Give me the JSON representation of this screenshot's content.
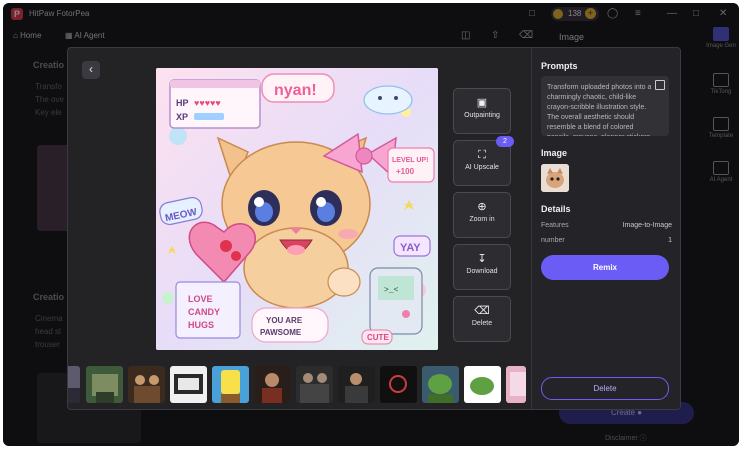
{
  "app": {
    "title": "HitPaw FotorPea",
    "coins": "138",
    "coin_plus": "+"
  },
  "nav": {
    "home": "Home",
    "ai_agent": "AI Agent"
  },
  "right_panel": {
    "title": "Image",
    "rail": [
      "Image Gen",
      "TikTong",
      "Template",
      "AI Agent"
    ],
    "create_label": "Create",
    "disclaimer": "Disclaimer"
  },
  "background": {
    "section1_title": "Creatio",
    "section1_lines": [
      "Transfo",
      "The ove",
      "Key ele"
    ],
    "section2_title": "Creatio",
    "section2_lines": [
      "Cinema",
      "head sl",
      "trouser"
    ]
  },
  "modal": {
    "back_icon": "chevron-left-icon",
    "tools": [
      {
        "id": "outpainting",
        "label": "Outpainting",
        "icon": "outpaint-icon"
      },
      {
        "id": "ai-upscale",
        "label": "AI Upscale",
        "icon": "upscale-icon",
        "badge": "2"
      },
      {
        "id": "zoom-in",
        "label": "Zoom in",
        "icon": "zoom-in-icon"
      },
      {
        "id": "download",
        "label": "Download",
        "icon": "download-icon"
      },
      {
        "id": "delete",
        "label": "Delete",
        "icon": "trash-icon"
      }
    ],
    "image_text": {
      "hp": "HP",
      "xp": "XP",
      "nyan": "nyan!",
      "meow": "MEOW",
      "level_up": "LEVEL UP!",
      "plus100": "+100",
      "yay": "YAY",
      "love": "LOVE",
      "candy": "CANDY",
      "hugs": "HUGS",
      "you_are": "YOU ARE",
      "pawsome": "PAWSOME",
      "cute": "CUTE",
      "game_face": ">_<"
    },
    "thumbnails": [
      "thumb-1",
      "thumb-2",
      "thumb-3",
      "thumb-4",
      "thumb-5",
      "thumb-6",
      "thumb-7",
      "thumb-8",
      "thumb-9",
      "thumb-10",
      "thumb-11",
      "thumb-12"
    ]
  },
  "details_panel": {
    "prompts_title": "Prompts",
    "prompt_text": "Transform uploaded photos into a charmingly chaotic, child-like crayon-scribble illustration style. The overall aesthetic should resemble a blend of colored pencils, crayons, planner stickers",
    "image_title": "Image",
    "details_title": "Details",
    "features_label": "Features",
    "features_value": "Image-to-Image",
    "number_label": "number",
    "number_value": "1",
    "remix_label": "Remix",
    "delete_label": "Delete"
  },
  "colors": {
    "accent": "#6b5cf6",
    "panel": "#242428",
    "brand": "#e23c52"
  }
}
